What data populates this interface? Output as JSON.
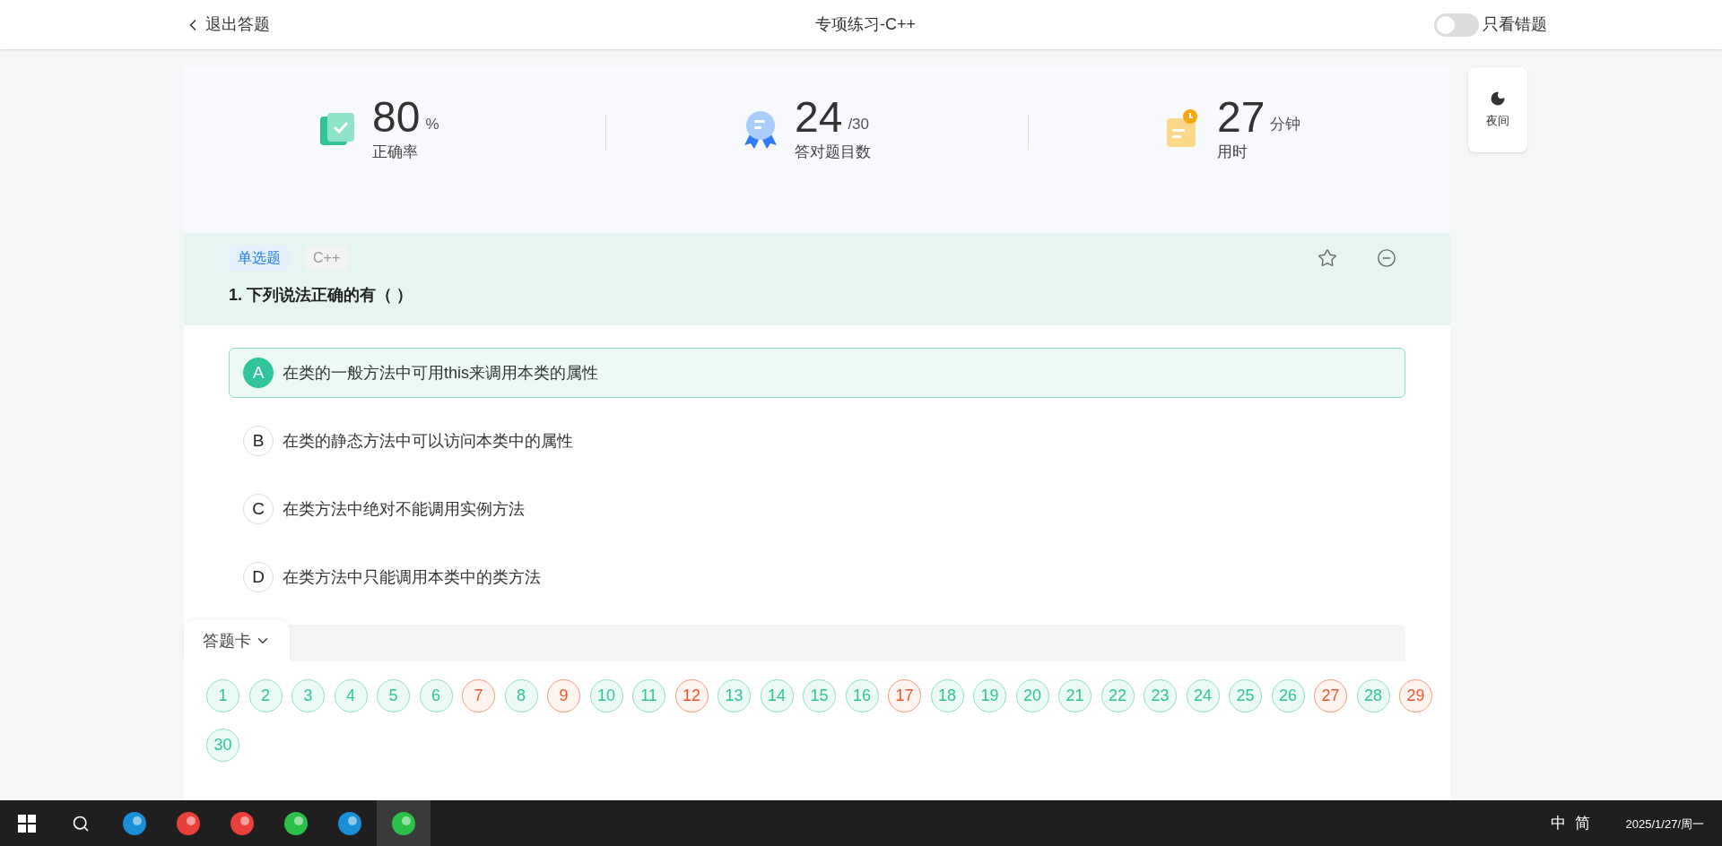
{
  "header": {
    "back": "退出答题",
    "title": "专项练习-C++",
    "toggle": {
      "label": "只看错题",
      "on": false
    }
  },
  "stats": [
    {
      "kind": "accuracy",
      "value": "80",
      "unit": "%",
      "label": "正确率"
    },
    {
      "kind": "correct",
      "value": "24",
      "unit": "/30",
      "label": "答对题目数"
    },
    {
      "kind": "time",
      "value": "27",
      "unit": "分钟",
      "label": "用时"
    }
  ],
  "night": {
    "label": "夜间"
  },
  "question": {
    "type_tag": "单选题",
    "lang_tag": "C++",
    "title": "1. 下列说法正确的有（ ）",
    "options": [
      {
        "letter": "A",
        "text": "在类的一般方法中可用this来调用本类的属性",
        "selected": true
      },
      {
        "letter": "B",
        "text": "在类的静态方法中可以访问本类中的属性",
        "selected": false
      },
      {
        "letter": "C",
        "text": "在类方法中绝对不能调用实例方法",
        "selected": false
      },
      {
        "letter": "D",
        "text": "在类方法中只能调用本类中的类方法",
        "selected": false
      }
    ]
  },
  "answer_card": {
    "label": "答题卡",
    "numbers": [
      {
        "label": "1",
        "correct": true
      },
      {
        "label": "2",
        "correct": true
      },
      {
        "label": "3",
        "correct": true
      },
      {
        "label": "4",
        "correct": true
      },
      {
        "label": "5",
        "correct": true
      },
      {
        "label": "6",
        "correct": true
      },
      {
        "label": "7",
        "correct": false
      },
      {
        "label": "8",
        "correct": true
      },
      {
        "label": "9",
        "correct": false
      },
      {
        "label": "10",
        "correct": true
      },
      {
        "label": "11",
        "correct": true
      },
      {
        "label": "12",
        "correct": false
      },
      {
        "label": "13",
        "correct": true
      },
      {
        "label": "14",
        "correct": true
      },
      {
        "label": "15",
        "correct": true
      },
      {
        "label": "16",
        "correct": true
      },
      {
        "label": "17",
        "correct": false
      },
      {
        "label": "18",
        "correct": true
      },
      {
        "label": "19",
        "correct": true
      },
      {
        "label": "20",
        "correct": true
      },
      {
        "label": "21",
        "correct": true
      },
      {
        "label": "22",
        "correct": true
      },
      {
        "label": "23",
        "correct": true
      },
      {
        "label": "24",
        "correct": true
      },
      {
        "label": "25",
        "correct": true
      },
      {
        "label": "26",
        "correct": true
      },
      {
        "label": "27",
        "correct": false
      },
      {
        "label": "28",
        "correct": true
      },
      {
        "label": "29",
        "correct": false
      },
      {
        "label": "30",
        "correct": true
      }
    ]
  },
  "taskbar": {
    "tray": [
      "中",
      "简"
    ],
    "date": "2025/1/27/周一"
  }
}
